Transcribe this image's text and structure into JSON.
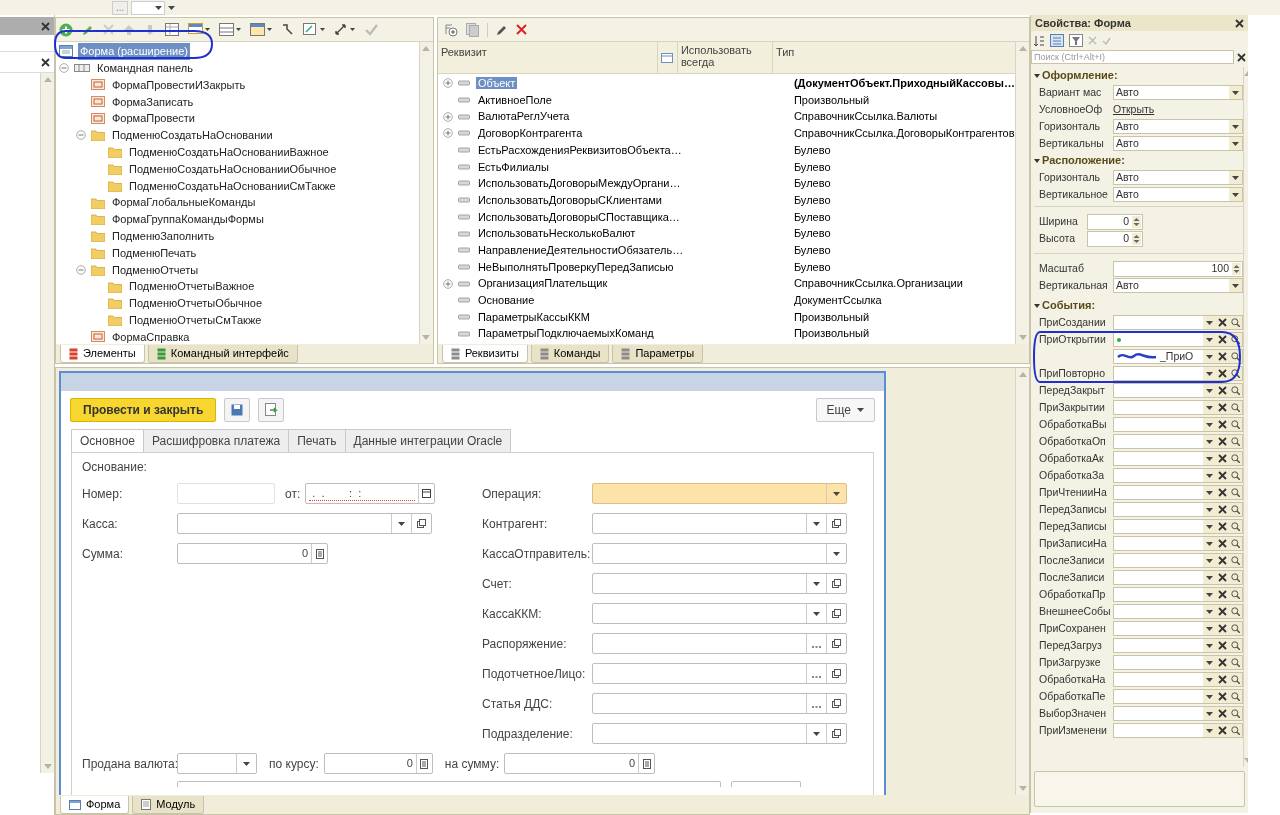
{
  "top_bar": {
    "ellipsis_button": "..."
  },
  "elements_panel": {
    "tree": [
      {
        "label": "Форма (расширение)",
        "kind": "form",
        "selected": true,
        "children": [
          {
            "label": "Командная панель",
            "kind": "command-bar",
            "selected": false,
            "expanded": true,
            "children": [
              {
                "label": "ФормаПровестиИЗакрыть",
                "kind": "button",
                "selected": false
              },
              {
                "label": "ФормаЗаписать",
                "kind": "button",
                "selected": false
              },
              {
                "label": "ФормаПровести",
                "kind": "button",
                "selected": false
              },
              {
                "label": "ПодменюСоздатьНаОсновании",
                "kind": "group",
                "selected": false,
                "expanded": true,
                "children": [
                  {
                    "label": "ПодменюСоздатьНаОснованииВажное",
                    "kind": "group",
                    "selected": false
                  },
                  {
                    "label": "ПодменюСоздатьНаОснованииОбычное",
                    "kind": "group",
                    "selected": false
                  },
                  {
                    "label": "ПодменюСоздатьНаОснованииСмТакже",
                    "kind": "group",
                    "selected": false
                  }
                ]
              },
              {
                "label": "ФормаГлобальныеКоманды",
                "kind": "group",
                "selected": false
              },
              {
                "label": "ФормаГруппаКомандыФормы",
                "kind": "group",
                "selected": false
              },
              {
                "label": "ПодменюЗаполнить",
                "kind": "group",
                "selected": false
              },
              {
                "label": "ПодменюПечать",
                "kind": "group",
                "selected": false
              },
              {
                "label": "ПодменюОтчеты",
                "kind": "group",
                "selected": false,
                "expanded": true,
                "children": [
                  {
                    "label": "ПодменюОтчетыВажное",
                    "kind": "group",
                    "selected": false
                  },
                  {
                    "label": "ПодменюОтчетыОбычное",
                    "kind": "group",
                    "selected": false
                  },
                  {
                    "label": "ПодменюОтчетыСмТакже",
                    "kind": "group",
                    "selected": false
                  }
                ]
              },
              {
                "label": "ФормаСправка",
                "kind": "button",
                "selected": false
              }
            ]
          }
        ]
      }
    ],
    "tabs": [
      {
        "label": "Элементы",
        "selected": true,
        "color": "#d9412b"
      },
      {
        "label": "Командный интерфейс",
        "selected": false,
        "color": "#3a9a3a"
      }
    ]
  },
  "attributes_panel": {
    "columns": [
      "Реквизит",
      "Использовать всегда",
      "Тип"
    ],
    "rows": [
      {
        "name": "Объект",
        "type": "(ДокументОбъект.ПриходныйКассовы…",
        "kind": "group",
        "selected": true,
        "main": true
      },
      {
        "name": "АктивноеПоле",
        "type": "Произвольный",
        "kind": "plain",
        "selected": false,
        "main": false
      },
      {
        "name": "ВалютаРеглУчета",
        "type": "СправочникСсылка.Валюты",
        "kind": "group",
        "selected": false,
        "main": false
      },
      {
        "name": "ДоговорКонтрагента",
        "type": "СправочникСсылка.ДоговорыКонтрагентов",
        "kind": "group",
        "selected": false,
        "main": false
      },
      {
        "name": "ЕстьРасхожденияРеквизитовОбъекта…",
        "type": "Булево",
        "kind": "plain",
        "selected": false,
        "main": false
      },
      {
        "name": "ЕстьФилиалы",
        "type": "Булево",
        "kind": "plain",
        "selected": false,
        "main": false
      },
      {
        "name": "ИспользоватьДоговорыМеждуОргани…",
        "type": "Булево",
        "kind": "plain",
        "selected": false,
        "main": false
      },
      {
        "name": "ИспользоватьДоговорыСКлиентами",
        "type": "Булево",
        "kind": "plain",
        "selected": false,
        "main": false
      },
      {
        "name": "ИспользоватьДоговорыСПоставщика…",
        "type": "Булево",
        "kind": "plain",
        "selected": false,
        "main": false
      },
      {
        "name": "ИспользоватьНесколькоВалют",
        "type": "Булево",
        "kind": "plain",
        "selected": false,
        "main": false
      },
      {
        "name": "НаправлениеДеятельностиОбязатель…",
        "type": "Булево",
        "kind": "plain",
        "selected": false,
        "main": false
      },
      {
        "name": "НеВыполнятьПроверкуПередЗаписью",
        "type": "Булево",
        "kind": "plain",
        "selected": false,
        "main": false
      },
      {
        "name": "ОрганизацияПлательщик",
        "type": "СправочникСсылка.Организации",
        "kind": "group",
        "selected": false,
        "main": false
      },
      {
        "name": "Основание",
        "type": "ДокументСсылка",
        "kind": "plain",
        "selected": false,
        "main": false
      },
      {
        "name": "ПараметрыКассыККМ",
        "type": "Произвольный",
        "kind": "plain",
        "selected": false,
        "main": false
      },
      {
        "name": "ПараметрыПодключаемыхКоманд",
        "type": "Произвольный",
        "kind": "plain",
        "selected": false,
        "main": false
      }
    ],
    "tabs": [
      {
        "label": "Реквизиты",
        "selected": true
      },
      {
        "label": "Команды",
        "selected": false
      },
      {
        "label": "Параметры",
        "selected": false
      }
    ]
  },
  "form_preview": {
    "primary_button": "Провести и закрыть",
    "more_button": "Еще",
    "tabs": [
      {
        "label": "Основное",
        "selected": true
      },
      {
        "label": "Расшифровка платежа",
        "selected": false
      },
      {
        "label": "Печать",
        "selected": false
      },
      {
        "label": "Данные интеграции Oracle",
        "selected": false
      }
    ],
    "caption": "Основание:",
    "left_fields": [
      {
        "label": "Номер:",
        "kind": "code",
        "disabled": true,
        "date": {
          "label": "от:",
          "mask": " .  .        :  :"
        }
      },
      {
        "label": "Касса:",
        "kind": "select-open",
        "disabled": false
      },
      {
        "label": "Сумма:",
        "kind": "number",
        "disabled": false,
        "value": "0"
      }
    ],
    "right_fields": [
      {
        "label": "Операция:",
        "kind": "select",
        "highlighted": true
      },
      {
        "label": "Контрагент:",
        "kind": "select-open",
        "highlighted": false
      },
      {
        "label": "КассаОтправитель:",
        "kind": "select",
        "highlighted": false
      },
      {
        "label": "Счет:",
        "kind": "select-open",
        "highlighted": false
      },
      {
        "label": "КассаККМ:",
        "kind": "select-open",
        "highlighted": false
      },
      {
        "label": "Распоряжение:",
        "kind": "choice-open",
        "highlighted": false
      },
      {
        "label": "ПодотчетноеЛицо:",
        "kind": "choice-open",
        "highlighted": false
      },
      {
        "label": "Статья ДДС:",
        "kind": "choice-open",
        "highlighted": false
      },
      {
        "label": "Подразделение:",
        "kind": "select-open",
        "highlighted": false
      }
    ],
    "bottom_row": [
      {
        "label": "Продана валюта:",
        "kind": "select"
      },
      {
        "label": "по курсу:",
        "kind": "number",
        "value": "0"
      },
      {
        "label": "на сумму:",
        "kind": "number",
        "value": "0"
      }
    ],
    "bottom_tabs": [
      {
        "label": "Форма",
        "selected": true
      },
      {
        "label": "Модуль",
        "selected": false
      }
    ]
  },
  "properties": {
    "title": "Свойства: Форма",
    "search_placeholder": "Поиск (Ctrl+Alt+I)",
    "sections": [
      {
        "title": "Оформление:",
        "expanded": true,
        "rows": [
          {
            "label": "Вариант мас",
            "kind": "select",
            "value": "Авто"
          },
          {
            "label": "УсловноеОф",
            "kind": "link",
            "value": "Открыть"
          },
          {
            "label": "Горизонталь",
            "kind": "select",
            "value": "Авто"
          },
          {
            "label": "Вертикальны",
            "kind": "select",
            "value": "Авто"
          }
        ]
      },
      {
        "title": "Расположение:",
        "expanded": true,
        "rows": [
          {
            "label": "Горизонталь",
            "kind": "select",
            "value": "Авто"
          },
          {
            "label": "Вертикальное",
            "kind": "select",
            "value": "Авто"
          }
        ]
      },
      {
        "rows": [
          {
            "label": "Ширина",
            "kind": "spin",
            "value": "0"
          },
          {
            "label": "Высота",
            "kind": "spin",
            "value": "0"
          }
        ]
      },
      {
        "rows": [
          {
            "label": "Масштаб",
            "kind": "spin-wide",
            "value": "100"
          },
          {
            "label": "Вертикальная",
            "kind": "select",
            "value": "Авто"
          }
        ]
      },
      {
        "title": "События:",
        "expanded": true,
        "rows": [
          {
            "label": "ПриСоздании",
            "kind": "event",
            "flagged": false
          },
          {
            "label": "ПриОткрытии",
            "kind": "event",
            "flagged": true
          },
          {
            "kind": "event",
            "value": "_ПриО",
            "flagged": false
          },
          {
            "label": "ПриПовторно",
            "kind": "event",
            "flagged": false
          },
          {
            "label": "ПередЗакрыт",
            "kind": "event",
            "flagged": false
          },
          {
            "label": "ПриЗакрытии",
            "kind": "event",
            "flagged": false
          },
          {
            "label": "ОбработкаВы",
            "kind": "event",
            "flagged": false
          },
          {
            "label": "ОбработкаОп",
            "kind": "event",
            "flagged": false
          },
          {
            "label": "ОбработкаАк",
            "kind": "event",
            "flagged": false
          },
          {
            "label": "ОбработкаЗа",
            "kind": "event",
            "flagged": false
          },
          {
            "label": "ПриЧтенииНа",
            "kind": "event",
            "flagged": false
          },
          {
            "label": "ПередЗаписы",
            "kind": "event",
            "flagged": false
          },
          {
            "label": "ПередЗаписы",
            "kind": "event",
            "flagged": false
          },
          {
            "label": "ПриЗаписиНа",
            "kind": "event",
            "flagged": false
          },
          {
            "label": "ПослеЗаписи",
            "kind": "event",
            "flagged": false
          },
          {
            "label": "ПослеЗаписи",
            "kind": "event",
            "flagged": false
          },
          {
            "label": "ОбработкаПр",
            "kind": "event",
            "flagged": false
          },
          {
            "label": "ВнешнееСобы",
            "kind": "event",
            "flagged": false
          },
          {
            "label": "ПриСохранен",
            "kind": "event",
            "flagged": false
          },
          {
            "label": "ПередЗагруз",
            "kind": "event",
            "flagged": false
          },
          {
            "label": "ПриЗагрузке",
            "kind": "event",
            "flagged": false
          },
          {
            "label": "ОбработкаНа",
            "kind": "event",
            "flagged": false
          },
          {
            "label": "ОбработкаПе",
            "kind": "event",
            "flagged": false
          },
          {
            "label": "ВыборЗначен",
            "kind": "event",
            "flagged": false
          },
          {
            "label": "ПриИзменени",
            "kind": "event",
            "flagged": false
          }
        ]
      }
    ]
  }
}
